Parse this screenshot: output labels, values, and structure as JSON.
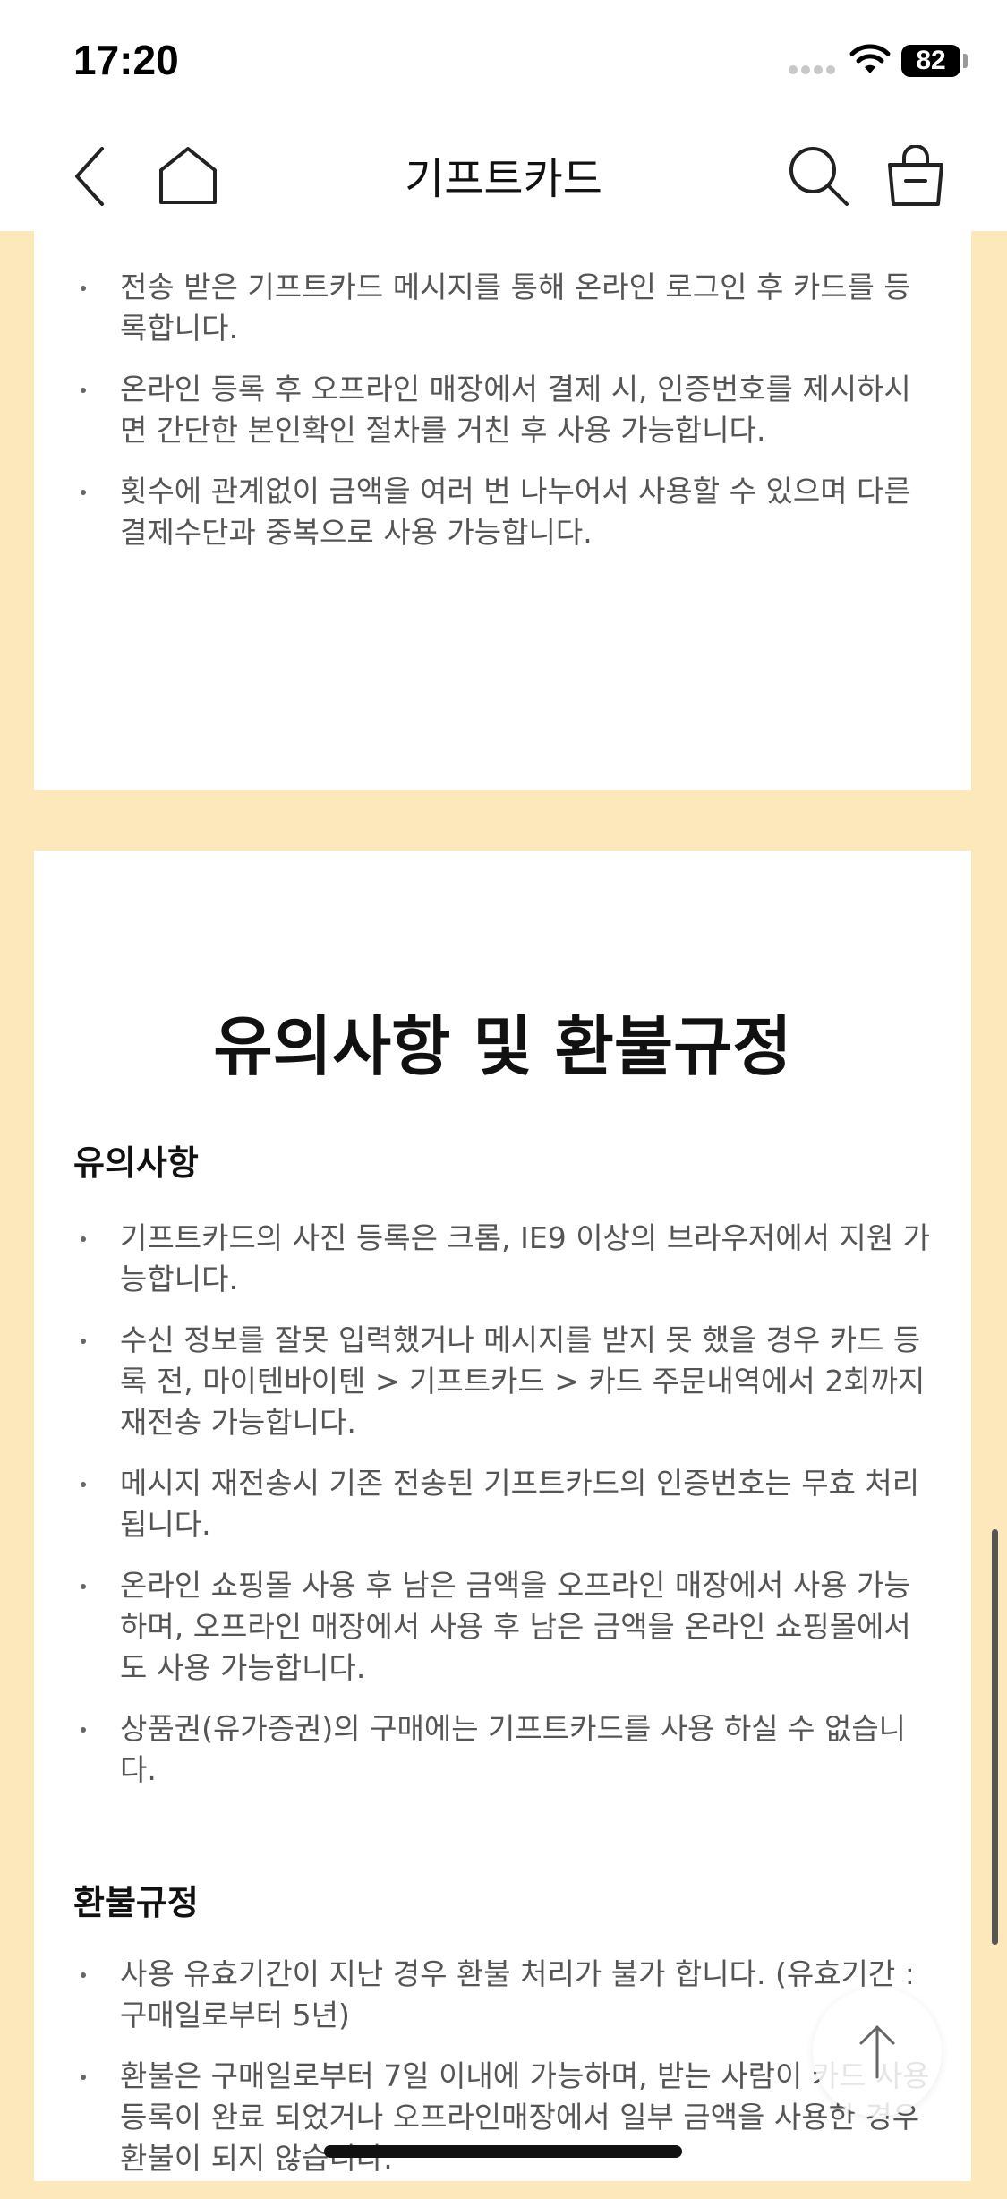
{
  "status_bar": {
    "time": "17:20",
    "battery": "82"
  },
  "header": {
    "title": "기프트카드",
    "back_icon": "chevron-left-icon",
    "home_icon": "home-icon",
    "search_icon": "search-icon",
    "bag_icon": "shopping-bag-icon"
  },
  "usage": {
    "items": [
      "전송 받은 기프트카드 메시지를 통해 온라인 로그인 후 카드를 등록합니다.",
      "온라인 등록 후 오프라인 매장에서 결제 시, 인증번호를 제시하시면 간단한 본인확인 절차를 거친 후 사용 가능합니다.",
      "횟수에 관계없이 금액을 여러 번 나누어서 사용할 수 있으며 다른 결제수단과 중복으로 사용 가능합니다."
    ]
  },
  "notice": {
    "title": "유의사항 및 환불규정",
    "caution_heading": "유의사항",
    "caution_items": [
      "기프트카드의 사진 등록은 크롬, IE9 이상의 브라우저에서 지원 가능합니다.",
      "수신 정보를 잘못 입력했거나 메시지를 받지 못 했을 경우 카드 등록 전, 마이텐바이텐 > 기프트카드 > 카드 주문내역에서 2회까지 재전송 가능합니다.",
      "메시지 재전송시 기존 전송된 기프트카드의 인증번호는 무효 처리됩니다.",
      "온라인 쇼핑몰 사용 후 남은 금액을 오프라인 매장에서 사용 가능하며, 오프라인 매장에서 사용 후 남은 금액을 온라인 쇼핑몰에서도 사용 가능합니다.",
      "상품권(유가증권)의 구매에는 기프트카드를 사용 하실 수 없습니다."
    ],
    "refund_heading": "환불규정",
    "refund_items": [
      "사용 유효기간이 지난 경우 환불 처리가 불가 합니다. (유효기간 : 구매일로부터 5년)",
      "환불은 구매일로부터 7일 이내에 가능하며, 받는 사람이 카드 사용 등록이 완료 되었거나 오프라인매장에서 일부 금액을 사용한 경우 환불이 되지 않습니다."
    ]
  },
  "scroll_top_icon": "arrow-up-icon",
  "colors": {
    "background": "#fde8bc",
    "card": "#ffffff"
  }
}
